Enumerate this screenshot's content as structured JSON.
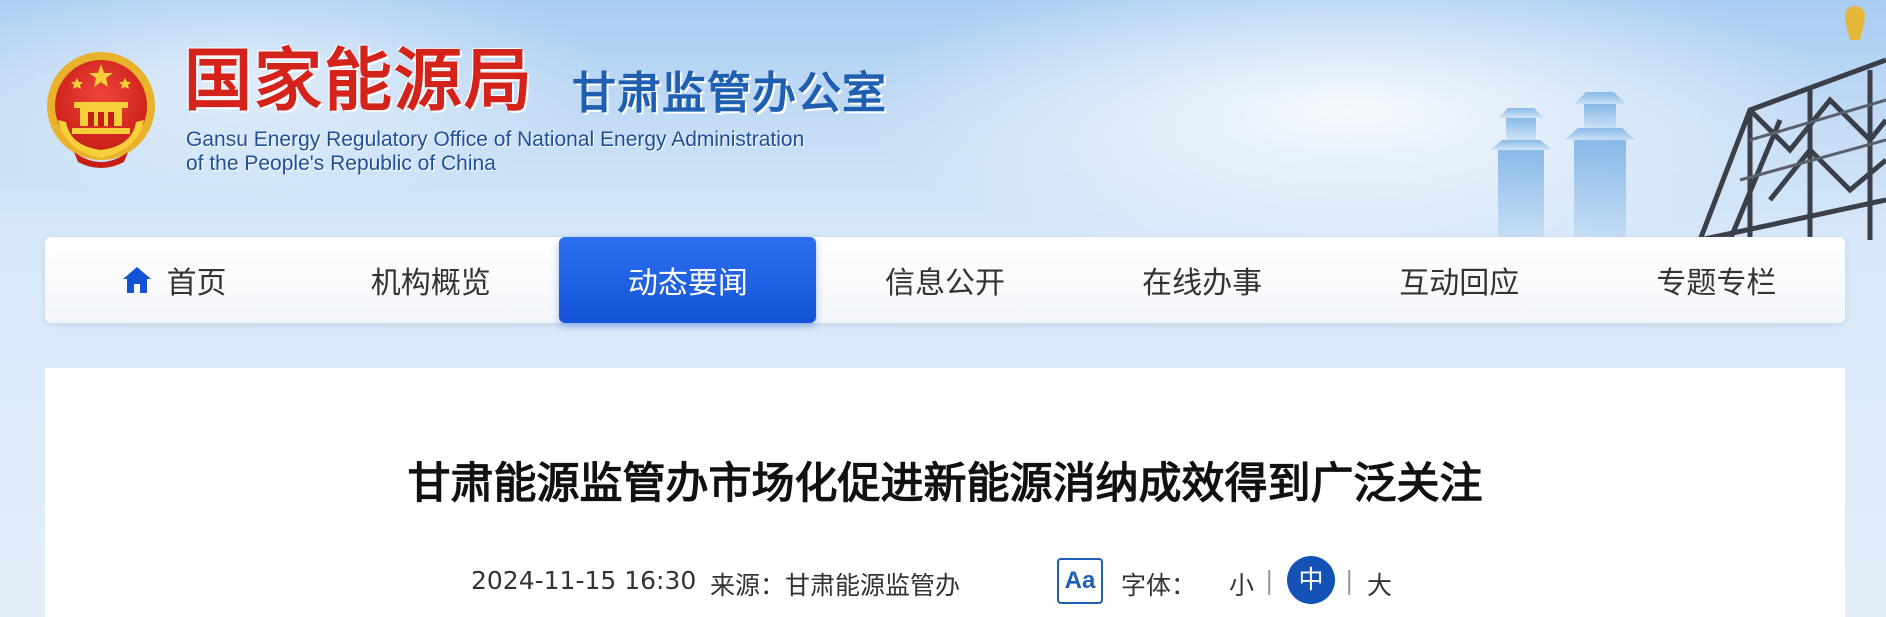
{
  "header": {
    "title_cn": "国家能源局",
    "subtitle_cn": "甘肃监管办公室",
    "title_en_line1": "Gansu Energy Regulatory Office of National Energy Administration",
    "title_en_line2": "of the People's Republic of China"
  },
  "nav": {
    "items": [
      {
        "label": "首页",
        "icon": "home-icon",
        "active": false
      },
      {
        "label": "机构概览",
        "active": false
      },
      {
        "label": "动态要闻",
        "active": true
      },
      {
        "label": "信息公开",
        "active": false
      },
      {
        "label": "在线办事",
        "active": false
      },
      {
        "label": "互动回应",
        "active": false
      },
      {
        "label": "专题专栏",
        "active": false
      }
    ]
  },
  "article": {
    "title": "甘肃能源监管办市场化促进新能源消纳成效得到广泛关注",
    "date": "2024-11-15 16:30",
    "source": "来源：甘肃能源监管办",
    "font_icon": "Aa",
    "font_label": "字体：",
    "font_small": "小",
    "font_medium": "中",
    "font_large": "大",
    "separator": "|"
  },
  "colors": {
    "title_red": "#d3231b",
    "brand_blue": "#1f5fb1",
    "nav_active": "#1553d6"
  }
}
